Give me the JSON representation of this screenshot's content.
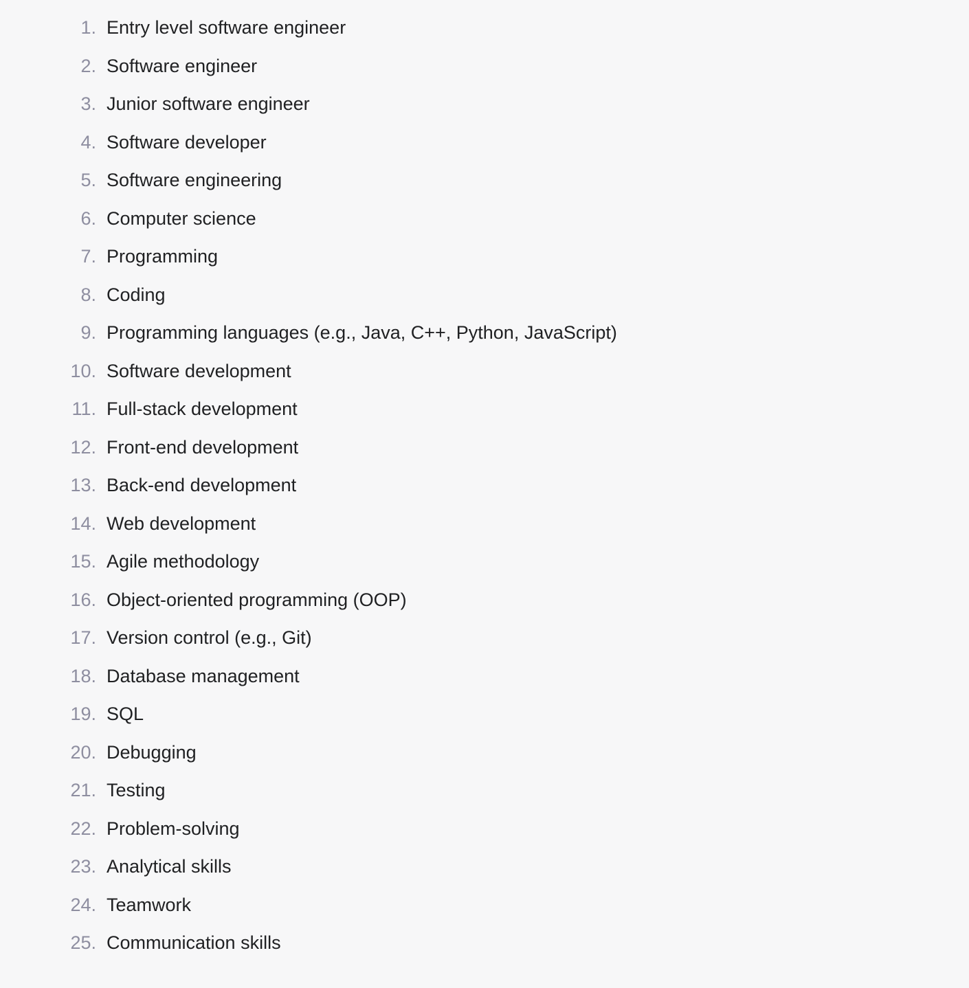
{
  "list": {
    "items": [
      {
        "label": "Entry level software engineer"
      },
      {
        "label": "Software engineer"
      },
      {
        "label": "Junior software engineer"
      },
      {
        "label": "Software developer"
      },
      {
        "label": "Software engineering"
      },
      {
        "label": "Computer science"
      },
      {
        "label": "Programming"
      },
      {
        "label": "Coding"
      },
      {
        "label": "Programming languages (e.g., Java, C++, Python, JavaScript)"
      },
      {
        "label": "Software development"
      },
      {
        "label": "Full-stack development"
      },
      {
        "label": "Front-end development"
      },
      {
        "label": "Back-end development"
      },
      {
        "label": "Web development"
      },
      {
        "label": "Agile methodology"
      },
      {
        "label": "Object-oriented programming (OOP)"
      },
      {
        "label": "Version control (e.g., Git)"
      },
      {
        "label": "Database management"
      },
      {
        "label": "SQL"
      },
      {
        "label": "Debugging"
      },
      {
        "label": "Testing"
      },
      {
        "label": "Problem-solving"
      },
      {
        "label": "Analytical skills"
      },
      {
        "label": "Teamwork"
      },
      {
        "label": "Communication skills"
      }
    ]
  }
}
